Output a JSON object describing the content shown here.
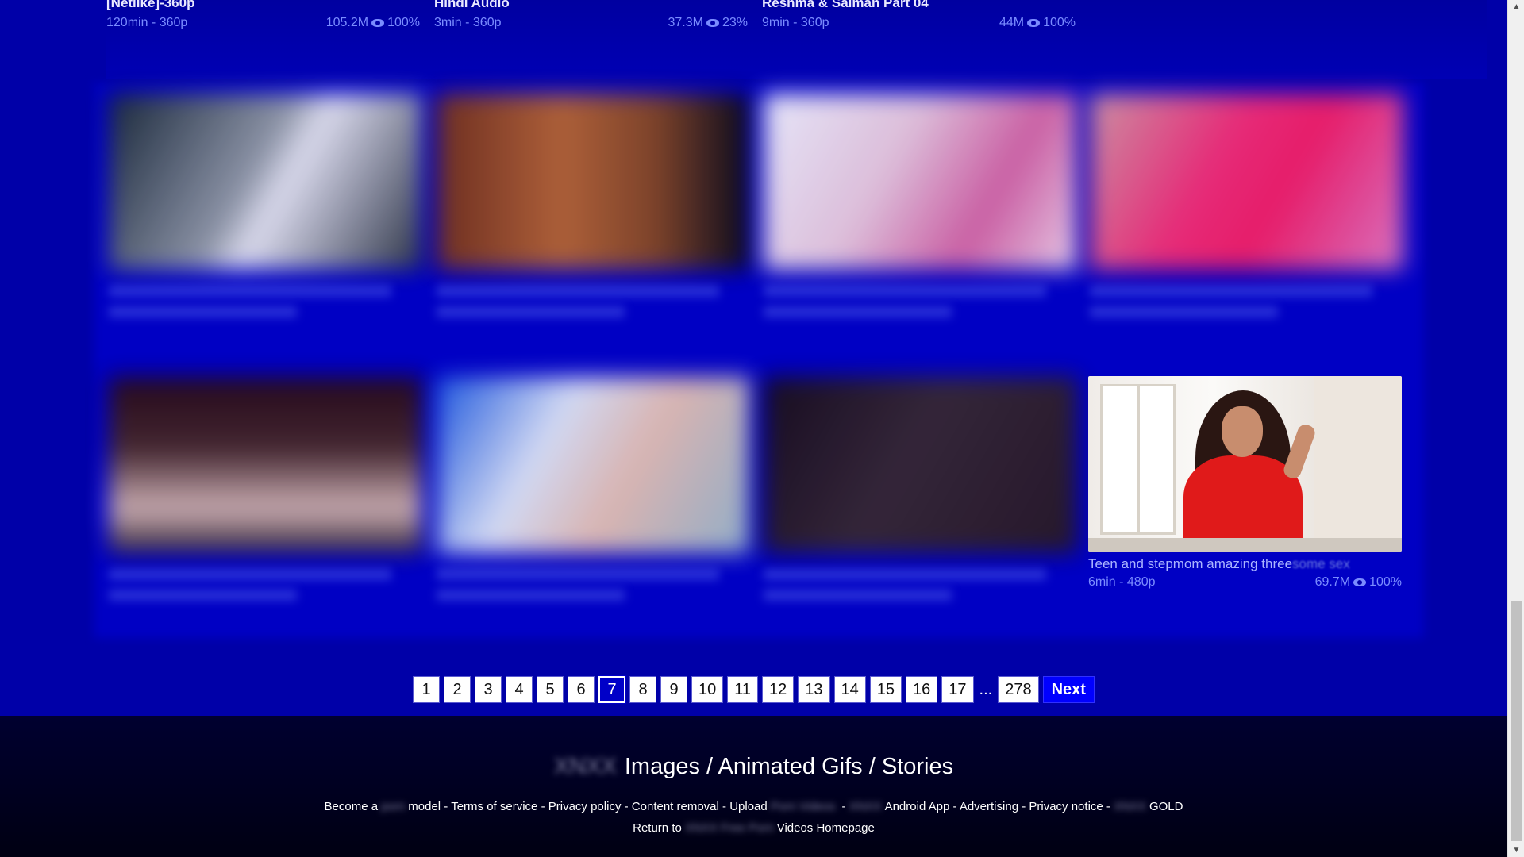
{
  "top_row": [
    {
      "title": "[Netlike]-360p",
      "duration": "120min - 360p",
      "views": "105.2M",
      "rating": "100%"
    },
    {
      "title": "Hindi Audio",
      "duration": "3min - 360p",
      "views": "37.3M",
      "rating": "23%"
    },
    {
      "title": "Reshma & Salman Part 04",
      "duration": "9min - 360p",
      "views": "44M",
      "rating": "100%"
    }
  ],
  "featured_card": {
    "title": "Teen and stepmom amazing threesome sex",
    "duration": "6min - 480p",
    "views": "69.7M",
    "rating": "100%"
  },
  "pagination": {
    "pages": [
      "1",
      "2",
      "3",
      "4",
      "5",
      "6",
      "7",
      "8",
      "9",
      "10",
      "11",
      "12",
      "13",
      "14",
      "15",
      "16",
      "17"
    ],
    "active_page": "7",
    "ellipsis": "...",
    "last_page": "278",
    "next_label": "Next"
  },
  "footer": {
    "title_blurred": "XNXX",
    "title": "Images / Animated Gifs / Stories",
    "links": {
      "become_a": "Become a",
      "become_blur": "porn",
      "model": "model",
      "sep": "-",
      "terms": "Terms of service",
      "privacy": "Privacy policy",
      "content_removal": "Content removal",
      "upload": "Upload",
      "upload_blur": "Porn Videos",
      "android_blur": "XNXX",
      "android": "Android App",
      "advertising": "Advertising",
      "privacy_notice": "Privacy notice",
      "gold_blur": "XNXX",
      "gold": "GOLD"
    },
    "return_to": "Return to",
    "return_blur": "XNXX Free Porn",
    "return_tail": "Videos Homepage"
  },
  "icons": {
    "views": "eye-icon",
    "scroll_up": "arrow-up-icon",
    "scroll_down": "arrow-down-icon"
  },
  "colors": {
    "background": "#0000a8",
    "accent": "#0000ff",
    "meta_text": "#7a8cff",
    "footer_bg": "#000020"
  }
}
